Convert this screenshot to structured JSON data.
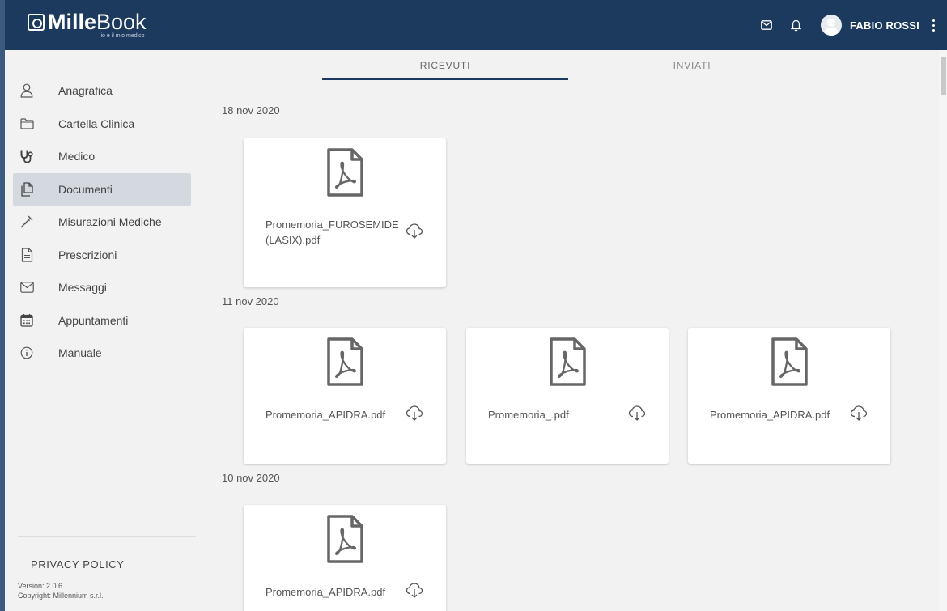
{
  "header": {
    "logo_bold": "Mille",
    "logo_light": "Book",
    "logo_tagline": "io e il mio medico",
    "user_name": "FABIO ROSSI",
    "icons": [
      "mail-icon",
      "bell-icon",
      "avatar",
      "more-vert-icon"
    ]
  },
  "sidebar": {
    "items": [
      {
        "label": "Anagrafica",
        "icon": "person-icon"
      },
      {
        "label": "Cartella Clinica",
        "icon": "folder-icon"
      },
      {
        "label": "Medico",
        "icon": "stethoscope-icon"
      },
      {
        "label": "Documenti",
        "icon": "documents-icon",
        "active": true
      },
      {
        "label": "Misurazioni Mediche",
        "icon": "dropper-icon"
      },
      {
        "label": "Prescrizioni",
        "icon": "prescription-icon"
      },
      {
        "label": "Messaggi",
        "icon": "mail-icon"
      },
      {
        "label": "Appuntamenti",
        "icon": "calendar-icon"
      },
      {
        "label": "Manuale",
        "icon": "info-icon"
      }
    ],
    "privacy_label": "PRIVACY POLICY",
    "version": "Version: 2.0.6",
    "copyright": "Copyright: Millennium s.r.l."
  },
  "tabs": [
    {
      "label": "RICEVUTI",
      "active": true
    },
    {
      "label": "INVIATI",
      "active": false
    }
  ],
  "groups": [
    {
      "date": "18 nov 2020",
      "files": [
        "Promemoria_FUROSEMIDE (LASIX).pdf"
      ]
    },
    {
      "date": "11 nov 2020",
      "files": [
        "Promemoria_APIDRA.pdf",
        "Promemoria_.pdf",
        "Promemoria_APIDRA.pdf"
      ]
    },
    {
      "date": "10 nov 2020",
      "files": [
        "Promemoria_APIDRA.pdf"
      ]
    }
  ],
  "colors": {
    "header_bg": "#1c3a5e",
    "accent": "#1c3a5e",
    "active_nav_bg": "#d4d9e0",
    "page_bg": "#f2f2f2"
  }
}
